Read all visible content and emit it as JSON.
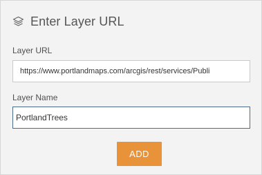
{
  "header": {
    "icon": "layers-icon",
    "title": "Enter Layer URL"
  },
  "form": {
    "url_label": "Layer URL",
    "url_value": "https://www.portlandmaps.com/arcgis/rest/services/Publi",
    "name_label": "Layer Name",
    "name_value": "PortlandTrees"
  },
  "actions": {
    "add_label": "ADD"
  },
  "colors": {
    "accent": "#e8923a",
    "panel_bg": "#f3f3f3",
    "focus_border": "#4a6c8c"
  }
}
